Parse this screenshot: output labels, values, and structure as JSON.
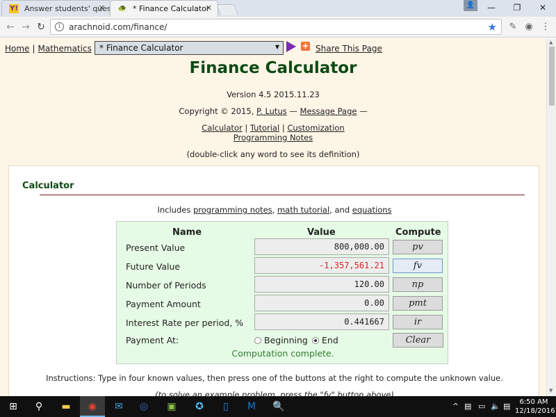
{
  "browser": {
    "tabs": [
      {
        "favicon": "Y!",
        "title": "Answer students' questio",
        "close": "✕"
      },
      {
        "favicon": "🐢",
        "title": "* Finance Calculator",
        "close": "✕"
      }
    ],
    "window_controls": {
      "minimize": "—",
      "restore": "❐",
      "close": "✕"
    },
    "address": "arachnoid.com/finance/"
  },
  "page": {
    "nav": {
      "home": "Home",
      "sep": "|",
      "mathematics": "Mathematics",
      "select_value": "* Finance Calculator",
      "share": "Share This Page"
    },
    "title": "Finance Calculator",
    "version": "Version 4.5 2015.11.23",
    "copyright": {
      "prefix": "Copyright © 2015,",
      "author": "P. Lutus",
      "dash": "—",
      "message": "Message Page",
      "suffix": "—"
    },
    "links": {
      "calculator": "Calculator",
      "sep": "|",
      "tutorial": "Tutorial",
      "customization": "Customization",
      "programming_notes": "Programming Notes"
    },
    "dblclick_hint": "(double-click any word to see its definition)",
    "section": {
      "title": "Calculator",
      "includes_prefix": "Includes",
      "includes_link1": "programming notes",
      "includes_comma": ",",
      "includes_link2": "math tutorial",
      "includes_and": ", and",
      "includes_link3": "equations"
    },
    "calculator": {
      "headers": {
        "name": "Name",
        "value": "Value",
        "compute": "Compute"
      },
      "rows": [
        {
          "label": "Present Value",
          "value": "800,000.00",
          "button": "pv"
        },
        {
          "label": "Future Value",
          "value": "-1,357,561.21",
          "button": "fv"
        },
        {
          "label": "Number of Periods",
          "value": "120.00",
          "button": "np"
        },
        {
          "label": "Payment Amount",
          "value": "0.00",
          "button": "pmt"
        },
        {
          "label": "Interest Rate per period, %",
          "value": "0.441667",
          "button": "ir"
        }
      ],
      "payment_at": {
        "label": "Payment At:",
        "option_beginning": "Beginning",
        "option_end": "End",
        "selected": "End"
      },
      "clear": "Clear",
      "status": "Computation complete."
    },
    "instructions": "Instructions: Type in four known values, then press one of the buttons at the right to compute the unknown value.",
    "example_hint": "(to solve an example problem, press the \"fv\" button above)"
  },
  "taskbar": {
    "time": "6:50 AM",
    "date": "12/18/2016"
  }
}
